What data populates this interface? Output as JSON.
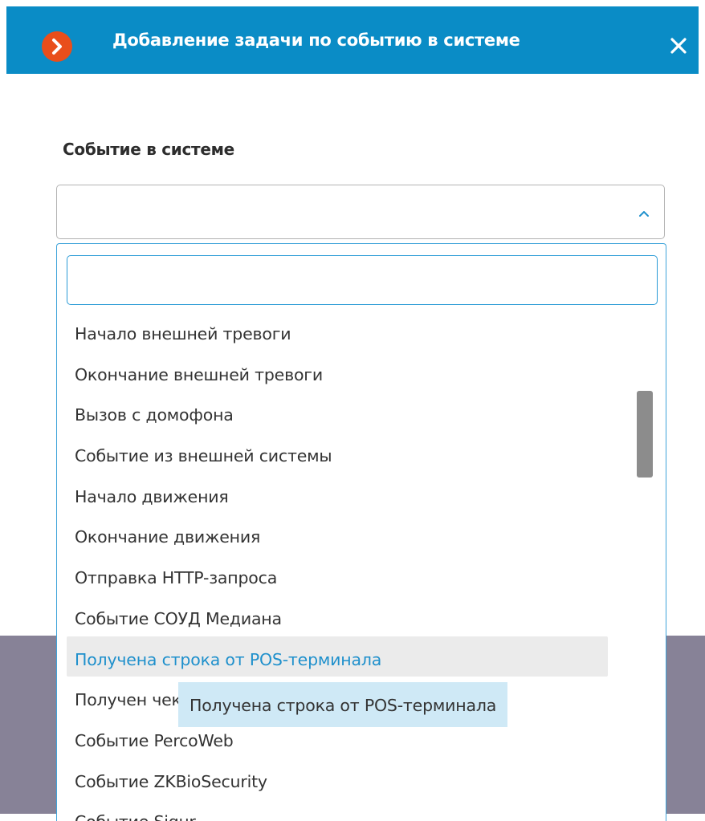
{
  "dialog": {
    "title": "Добавление задачи по событию в системе",
    "logo_icon": "chevron-right-logo-icon",
    "close_icon": "close-icon"
  },
  "form": {
    "event_label": "Событие в системе",
    "event_select_value": "",
    "event_select_icon": "chevron-up-icon"
  },
  "dropdown": {
    "search_value": "",
    "items": [
      {
        "label": "Начало внешней тревоги"
      },
      {
        "label": "Окончание внешней тревоги"
      },
      {
        "label": "Вызов с домофона"
      },
      {
        "label": "Событие из внешней системы"
      },
      {
        "label": "Начало движения"
      },
      {
        "label": "Окончание движения"
      },
      {
        "label": "Отправка HTTP-запроса"
      },
      {
        "label": "Событие СОУД Медиана"
      },
      {
        "label": "Получена строка от POS-терминала"
      },
      {
        "label": "Получен чек"
      },
      {
        "label": "Событие PercoWeb"
      },
      {
        "label": "Событие ZKBioSecurity"
      },
      {
        "label": "Событие Sigur"
      }
    ],
    "hovered_index": 8,
    "tooltip": "Получена строка от POS-терминала"
  },
  "colors": {
    "header": "#0a8cc6",
    "logo": "#e94e1b",
    "accent": "#1f90cc",
    "overlay": "#878297",
    "tooltip_bg": "#cfe9f6"
  }
}
